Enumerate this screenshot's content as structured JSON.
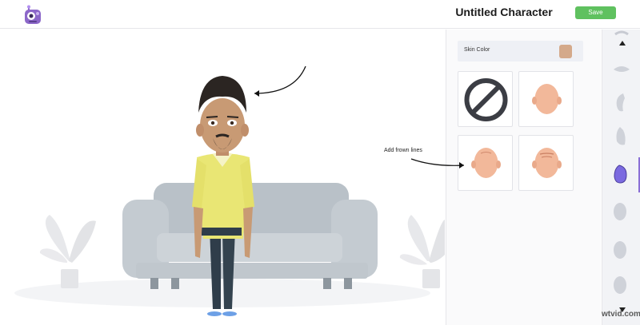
{
  "header": {
    "title": "Untitled Character",
    "save_label": "Save",
    "logo_icon": "robot-mascot-icon",
    "accent_color": "#5fc15f"
  },
  "stage": {
    "annotation": "Add frown lines",
    "scene_icons": [
      "sofa-icon",
      "plant-left-icon",
      "plant-right-icon",
      "character-icon",
      "arrow-icon"
    ]
  },
  "panel": {
    "skin_color_label": "Skin Color",
    "skin_color_value": "#d4a98a",
    "options": [
      {
        "name": "none-option",
        "icon": "no-symbol-icon"
      },
      {
        "name": "head-plain-option",
        "icon": "head-icon"
      },
      {
        "name": "head-frown-option-1",
        "icon": "head-frown-icon"
      },
      {
        "name": "head-frown-option-2",
        "icon": "head-frown-icon"
      }
    ]
  },
  "strip": {
    "items": [
      "eyebrows",
      "mouth",
      "ear-left",
      "ear-right",
      "face-shape",
      "head-1",
      "head-2",
      "head-3"
    ],
    "active": "face-shape",
    "active_color": "#8a6fd6"
  },
  "watermark": "wtvid.com"
}
